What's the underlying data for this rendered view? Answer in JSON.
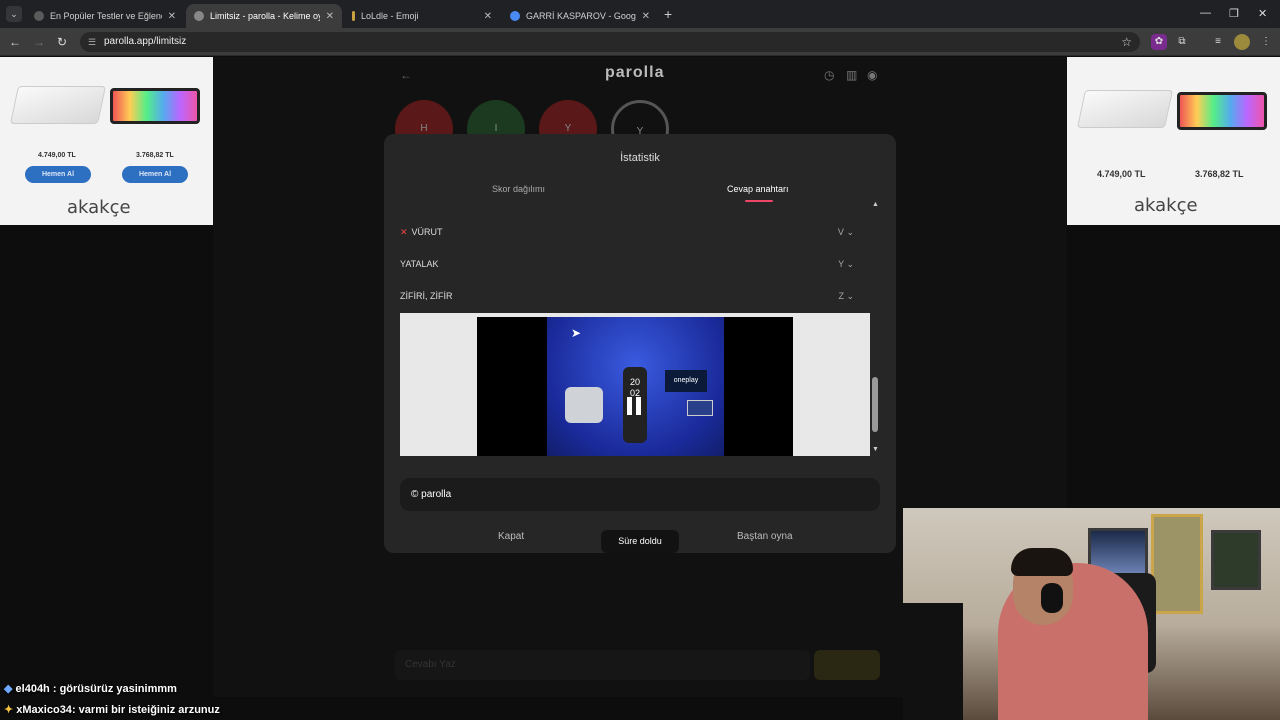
{
  "browser": {
    "tabs": [
      {
        "title": "En Popüler Testler ve Eğlenceli",
        "color": "#5a5a5a"
      },
      {
        "title": "Limitsiz - parolla - Kelime oyun",
        "color": "#888888"
      },
      {
        "title": "LoLdle - Emoji",
        "color": "#c8a040"
      },
      {
        "title": "GARRİ KASPAROV - Google'da",
        "color": "#4a8af4"
      }
    ],
    "url": "parolla.app/limitsiz"
  },
  "ads": {
    "left": {
      "price1": "4.749,00 TL",
      "price2": "3.768,82 TL",
      "btn": "Hemen Al",
      "logo": "akakçe"
    },
    "right": {
      "price1": "4.749,00 TL",
      "price2": "3.768,82 TL",
      "logo": "akakçe"
    }
  },
  "game": {
    "title": "parolla",
    "circles": [
      "H",
      "I",
      "Y",
      "Y"
    ],
    "input_placeholder": "Cevabı Yaz"
  },
  "modal": {
    "title": "İstatistik",
    "tabs": [
      "Skor dağılımı",
      "Cevap anahtarı"
    ],
    "rows": [
      {
        "word": "VÜRUT",
        "letter": "V",
        "wrong": true
      },
      {
        "word": "YATALAK",
        "letter": "Y",
        "wrong": false
      },
      {
        "word": "ZİFİRİ, ZİFİR",
        "letter": "Z",
        "wrong": false
      }
    ],
    "video": {
      "brand": "oneplay",
      "clock1": "20",
      "clock2": "02"
    },
    "credit": "© parolla",
    "close": "Kapat",
    "restart": "Baştan oyna",
    "toast": "Süre doldu"
  },
  "chat": [
    {
      "user": "el404h",
      "msg": "görüsürüz yasinimmm"
    },
    {
      "user": "xMaxico34",
      "msg": "varmi bir isteiğiniz arzunuz"
    }
  ]
}
